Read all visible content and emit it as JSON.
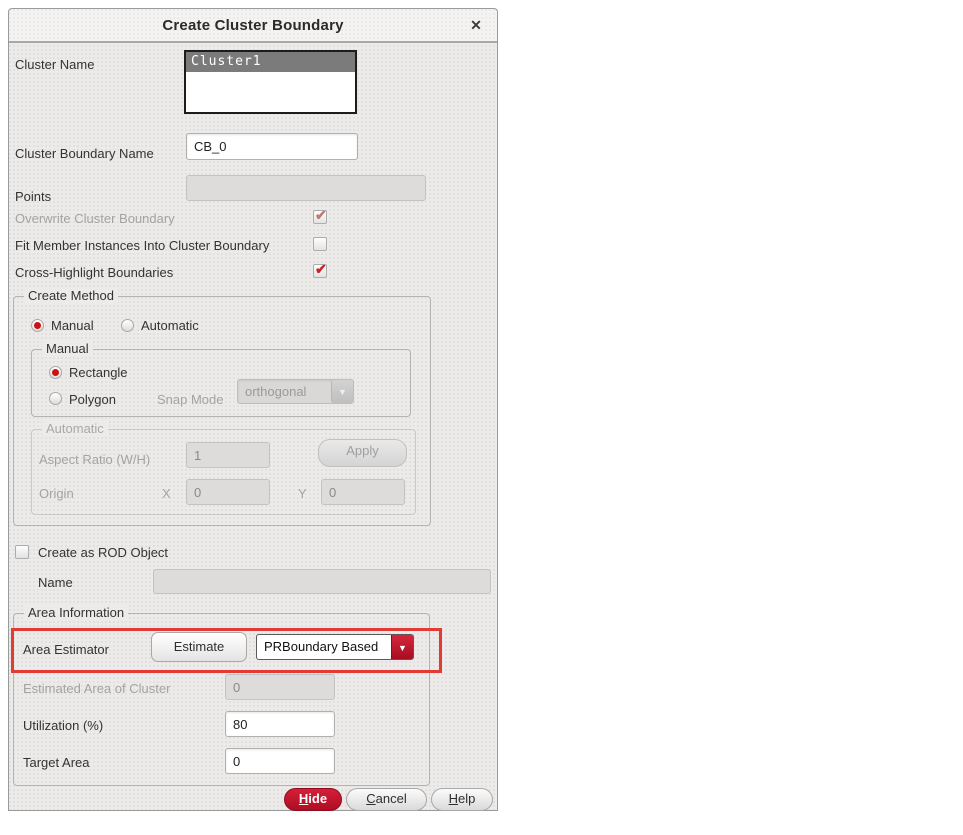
{
  "dialog": {
    "title": "Create Cluster Boundary",
    "close_icon": "✕"
  },
  "cluster_name": {
    "label": "Cluster Name",
    "selected_item": "Cluster1"
  },
  "cluster_boundary_name": {
    "label": "Cluster Boundary Name",
    "value": "CB_0"
  },
  "points": {
    "label": "Points",
    "value": ""
  },
  "options": {
    "overwrite": {
      "label": "Overwrite Cluster Boundary",
      "checked": true,
      "disabled": true
    },
    "fit_member": {
      "label": "Fit Member Instances Into Cluster Boundary",
      "checked": false,
      "disabled": false
    },
    "cross_highlight": {
      "label": "Cross-Highlight Boundaries",
      "checked": true,
      "disabled": false
    }
  },
  "create_method": {
    "legend": "Create Method",
    "manual_radio": "Manual",
    "automatic_radio": "Automatic",
    "selected": "Manual",
    "manual_group": {
      "legend": "Manual",
      "rectangle_radio": "Rectangle",
      "polygon_radio": "Polygon",
      "selected": "Rectangle",
      "snap_mode_label": "Snap Mode",
      "snap_mode_value": "orthogonal",
      "dropdown_arrow": "▼"
    },
    "automatic_group": {
      "legend": "Automatic",
      "aspect_ratio_label": "Aspect Ratio (W/H)",
      "aspect_ratio_value": "1",
      "apply_button": "Apply",
      "origin_label": "Origin",
      "x_label": "X",
      "x_value": "0",
      "y_label": "Y",
      "y_value": "0"
    }
  },
  "rod": {
    "checkbox_label": "Create as ROD Object",
    "checked": false,
    "name_label": "Name",
    "name_value": ""
  },
  "area_information": {
    "legend": "Area Information",
    "area_estimator_label": "Area Estimator",
    "estimate_button": "Estimate",
    "estimator_value": "PRBoundary Based",
    "dropdown_arrow": "▼",
    "estimated_area_label": "Estimated Area of Cluster",
    "estimated_area_value": "0",
    "utilization_label": "Utilization (%)",
    "utilization_value": "80",
    "target_area_label": "Target Area",
    "target_area_value": "0"
  },
  "footer": {
    "hide_button": "Hide",
    "cancel_button": "Cancel",
    "help_button": "Help"
  },
  "colors": {
    "accent_red": "#c0182c",
    "annotation_red": "#e23a34",
    "check_red": "#cc1f1f",
    "selection_gray": "#7b7b7b"
  }
}
